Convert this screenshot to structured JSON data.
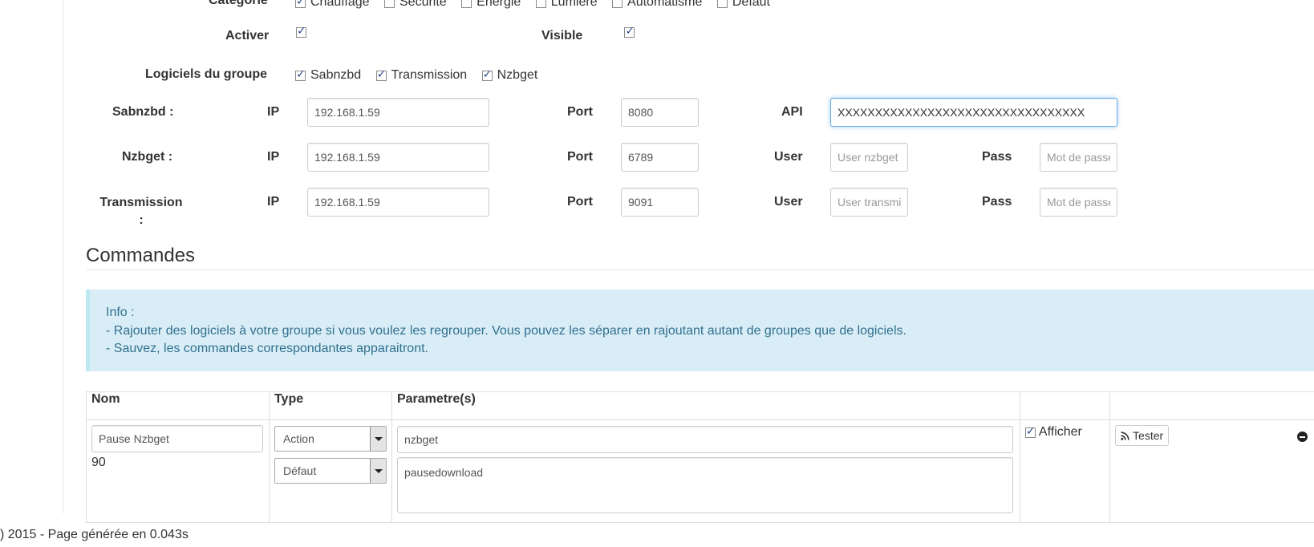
{
  "categorie": {
    "label": "Catégorie",
    "options": [
      {
        "label": "Chauffage",
        "checked": true
      },
      {
        "label": "Sécurité",
        "checked": false
      },
      {
        "label": "Energie",
        "checked": false
      },
      {
        "label": "Lumière",
        "checked": false
      },
      {
        "label": "Automatisme",
        "checked": false
      },
      {
        "label": "Défaut",
        "checked": false
      }
    ]
  },
  "activer": {
    "label": "Activer",
    "checked": true
  },
  "visible": {
    "label": "Visible",
    "checked": true
  },
  "logiciels": {
    "label": "Logiciels du groupe",
    "items": [
      {
        "label": "Sabnzbd",
        "checked": true
      },
      {
        "label": "Transmission",
        "checked": true
      },
      {
        "label": "Nzbget",
        "checked": true
      }
    ]
  },
  "sabnzbd": {
    "label": "Sabnzbd :",
    "ip_label": "IP",
    "ip": "192.168.1.59",
    "port_label": "Port",
    "port": "8080",
    "api_label": "API",
    "api": "XXXXXXXXXXXXXXXXXXXXXXXXXXXXXXXXX"
  },
  "nzbget": {
    "label": "Nzbget :",
    "ip_label": "IP",
    "ip": "192.168.1.59",
    "port_label": "Port",
    "port": "6789",
    "user_label": "User",
    "user_placeholder": "User nzbget",
    "pass_label": "Pass",
    "pass_placeholder": "Mot de passe"
  },
  "transmission": {
    "label": "Transmission :",
    "ip_label": "IP",
    "ip": "192.168.1.59",
    "port_label": "Port",
    "port": "9091",
    "user_label": "User",
    "user_placeholder": "User transmission",
    "pass_label": "Pass",
    "pass_placeholder": "Mot de passe"
  },
  "commandes": {
    "title": "Commandes",
    "info": {
      "line1": "Info :",
      "line2": "- Rajouter des logiciels à votre groupe si vous voulez les regrouper. Vous pouvez les séparer en rajoutant autant de groupes que de logiciels.",
      "line3": "- Sauvez, les commandes correspondantes apparaitront."
    },
    "table": {
      "headers": [
        "Nom",
        "Type",
        "Parametre(s)",
        "",
        ""
      ],
      "row": {
        "nom": "Pause Nzbget",
        "id": "90",
        "type": "Action",
        "subtype": "Défaut",
        "param1": "nzbget",
        "param2": "pausedownload",
        "afficher_label": "Afficher",
        "afficher_checked": true,
        "tester_label": "Tester"
      }
    }
  },
  "footer": ") 2015 - Page générée en 0.043s"
}
